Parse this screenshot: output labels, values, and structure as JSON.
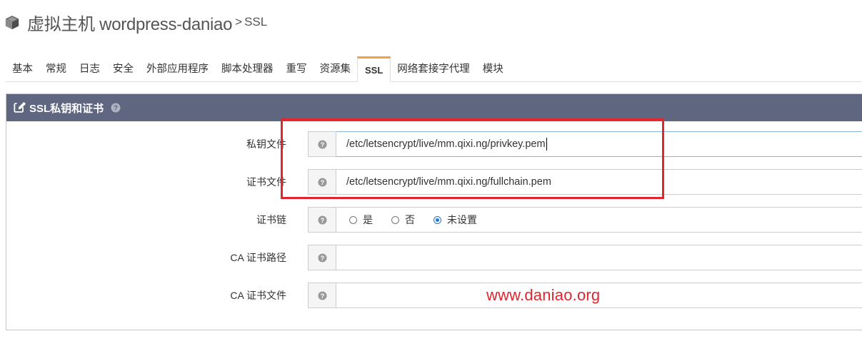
{
  "header": {
    "title_main": "虚拟主机 wordpress-daniao",
    "separator": ">",
    "title_sub": "SSL"
  },
  "tabs": [
    {
      "label": "基本"
    },
    {
      "label": "常规"
    },
    {
      "label": "日志"
    },
    {
      "label": "安全"
    },
    {
      "label": "外部应用程序"
    },
    {
      "label": "脚本处理器"
    },
    {
      "label": "重写"
    },
    {
      "label": "资源集"
    },
    {
      "label": "SSL",
      "active": true
    },
    {
      "label": "网络套接字代理"
    },
    {
      "label": "模块"
    }
  ],
  "panel": {
    "title": "SSL私钥和证书",
    "fields": [
      {
        "label": "私钥文件",
        "value": "/etc/letsencrypt/live/mm.qixi.ng/privkey.pem"
      },
      {
        "label": "证书文件",
        "value": "/etc/letsencrypt/live/mm.qixi.ng/fullchain.pem"
      },
      {
        "label": "证书链",
        "options": [
          "是",
          "否",
          "未设置"
        ],
        "selected": "未设置"
      },
      {
        "label": "CA 证书路径",
        "value": ""
      },
      {
        "label": "CA 证书文件",
        "value": ""
      }
    ]
  },
  "watermark": "www.daniao.org",
  "colors": {
    "panel_header": "#5f6680",
    "active_tab_accent": "#f0a040",
    "highlight": "#e0262f",
    "radio_checked": "#1f73d9"
  },
  "icons": {
    "title": "cube-icon",
    "panel": "edit-icon",
    "help": "question-circle-icon"
  }
}
